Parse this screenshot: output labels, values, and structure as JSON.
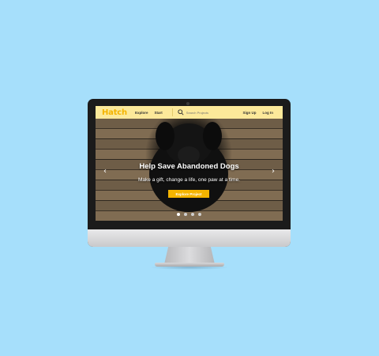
{
  "nav": {
    "logo": "Hatch",
    "links": [
      "Explore",
      "Start"
    ],
    "search_placeholder": "Search Projects",
    "right_links": [
      "Sign Up",
      "Log In"
    ]
  },
  "hero": {
    "title": "Help Save Abandoned Dogs",
    "subtitle": "Make a gift, change a life, one paw at a time.",
    "cta_label": "Explore Project",
    "carousel_slide_count": 4,
    "active_slide": 1
  },
  "colors": {
    "background": "#a6dffb",
    "nav_bg": "#fce99a",
    "brand_yellow": "#f4b400"
  },
  "icons": [
    "search-icon",
    "chevron-left-icon",
    "chevron-right-icon"
  ]
}
